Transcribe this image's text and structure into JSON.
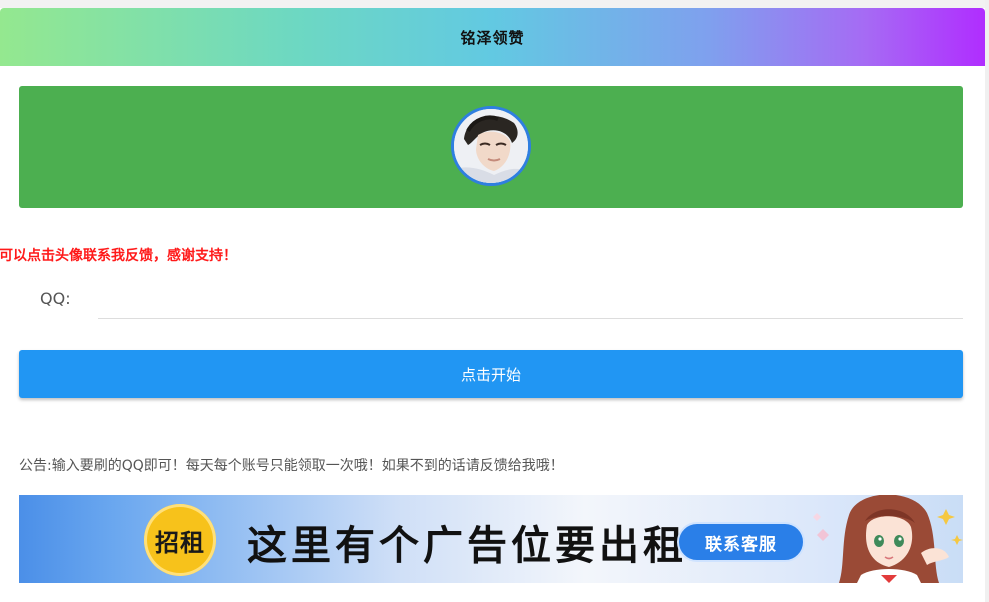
{
  "header": {
    "title": "铭泽领赞"
  },
  "profile": {
    "avatar_icon": "avatar-photo"
  },
  "notice": {
    "red_text": "问题可以点击头像联系我反馈，感谢支持！"
  },
  "form": {
    "qq_label": "QQ:",
    "qq_value": "",
    "qq_placeholder": ""
  },
  "actions": {
    "start_label": "点击开始"
  },
  "announcement": {
    "text": "公告:输入要刷的QQ即可！每天每个账号只能领取一次哦！如果不到的话请反馈给我哦！"
  },
  "ad": {
    "badge_text": "招租",
    "main_text": "这里有个广告位要出租",
    "contact_label": "联系客服"
  },
  "colors": {
    "header_gradient_start": "#94e88f",
    "header_gradient_end": "#b02dff",
    "panel_green": "#4caf50",
    "button_blue": "#2196f3",
    "notice_red": "#ff1a1a"
  }
}
